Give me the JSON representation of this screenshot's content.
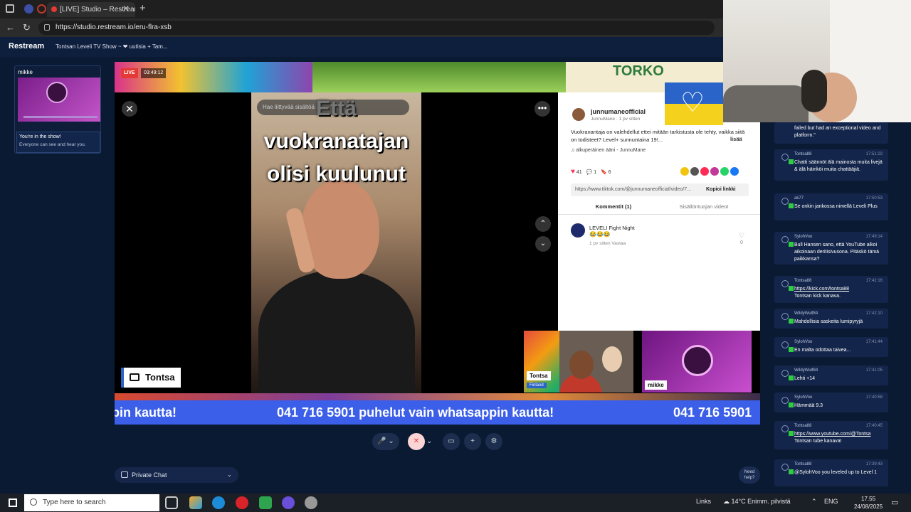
{
  "browser": {
    "tab_title": "[LIVE] Studio – Restream",
    "tab_close": "✕",
    "new_tab": "+",
    "url": "https://studio.restream.io/eru-flra-xsb"
  },
  "header": {
    "logo": "Restream",
    "show_title": "Tontsan Leveli TV Show ~ ❤ uutisia + Tam..."
  },
  "sidebar": {
    "guest_name": "mikke",
    "notice_title": "You're in the show!",
    "notice_text": "Everyone can see and hear you."
  },
  "stage": {
    "live_label": "LIVE",
    "timer": "03:49:12",
    "banner_text": "TORKO",
    "search_placeholder": "Hae liittyvää sisältöä",
    "caption": "Että\nvuokranatajan\nolisi kuulunut",
    "close_glyph": "✕",
    "more_glyph": "•••",
    "up_glyph": "⌃",
    "down_glyph": "⌄",
    "tiktok": {
      "username": "junnumaneofficial",
      "subline": "JunnuMane · 1 pv sitten",
      "description": "Vuokranantaja on valehdellut ettei mitään tarkistusta ole tehty, vaikka siitä on todisteet? Level+ sunnuntaina 19!...",
      "more": "lisää",
      "sound": "♫  alkuperäinen ääni - JunnuMane",
      "likes": "41",
      "comments": "1",
      "saves": "6",
      "link": "https://www.tiktok.com/@junnumaneofficial/video/7...",
      "copy_link": "Kopioi linkki",
      "tab_comments": "Kommentit (1)",
      "tab_creator": "Sisällöntuojan videot",
      "comment_author": "LEVELI Fight Night",
      "comment_text": "😂😂😂",
      "comment_meta": "1 pv sitten     Vastaa",
      "comment_like_count": "0"
    },
    "participant_main": "Tontsa",
    "tile1_name": "Tontsa",
    "tile1_country": "Finland",
    "tile2_name": "mikke",
    "ticker_left": "pin kautta!",
    "ticker_main": "041 716 5901 puhelut vain whatsappin kautta!",
    "ticker_right": "041 716 5901"
  },
  "controls": {
    "mic_icon": "🎤",
    "camera_icon": "✕",
    "screen_icon": "▭",
    "add_icon": "+",
    "settings_icon": "⚙",
    "private_chat": "Private Chat",
    "need_help": "Need help?"
  },
  "chat": {
    "messages": [
      {
        "author": "",
        "time": "",
        "text": "failed but had an exceptional video and platform.\""
      },
      {
        "author": "Tontsa88",
        "time": "17:51:23",
        "text": "Chatti säännöt älä mainosta muita livejä & älä häiriköi muita chattääjiä."
      },
      {
        "author": "ak77",
        "time": "17:50:53",
        "text": "Se onkin jankossa nimellä Leveli Plus"
      },
      {
        "author": "SylohVoo",
        "time": "17:49:14",
        "text": "Bull Hansen sano, että YouTube alkoi aikoinaan deritisivusona. Pitäskö tämä paikkansa?"
      },
      {
        "author": "Tontsa88",
        "time": "17:42:16",
        "text_link": "https://kick.com/tontsa88",
        "text": "Tontsan kick kanava."
      },
      {
        "author": "WildyWulf84",
        "time": "17:42:10",
        "text": "Mahdollisia saskeita lumipyryjä"
      },
      {
        "author": "SylohVoo",
        "time": "17:41:44",
        "text": "En malta odottaa taivea..."
      },
      {
        "author": "WildyWulf84",
        "time": "17:41:05",
        "text": "Lehti +14"
      },
      {
        "author": "SylohVoo",
        "time": "17:40:58",
        "text": "Hämmää 9.3"
      },
      {
        "author": "Tontsa88",
        "time": "17:40:45",
        "text_link": "https://www.youtube.com/@Tontsa",
        "text": "Tontsan tube kanava!"
      },
      {
        "author": "Tontsa88",
        "time": "17:39:43",
        "text": "@SylohVoo you leveled up to Level 1"
      }
    ]
  },
  "taskbar": {
    "search_placeholder": "Type here to search",
    "links": "Links",
    "weather": "14°C  Enimm. pilvistä",
    "lang": "ENG",
    "time": "17.55",
    "date": "24/08/2025"
  }
}
